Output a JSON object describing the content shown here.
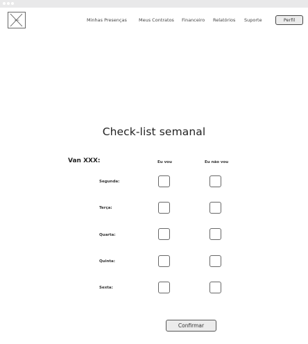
{
  "logo": {
    "text": "logo"
  },
  "nav": {
    "items": [
      {
        "label": "Minhas Presenças"
      },
      {
        "label": "Meus Contratos"
      },
      {
        "label": "Financeiro"
      },
      {
        "label": "Relatórios"
      },
      {
        "label": "Suporte"
      }
    ],
    "profile_label": "Perfil"
  },
  "main": {
    "title": "Check-list semanal",
    "van_label": "Van XXX:",
    "columns": [
      "Eu vou",
      "Eu não vou"
    ],
    "days": [
      {
        "label": "Segunda:",
        "eu_vou": false,
        "eu_nao_vou": false
      },
      {
        "label": "Terça:",
        "eu_vou": false,
        "eu_nao_vou": false
      },
      {
        "label": "Quarta:",
        "eu_vou": false,
        "eu_nao_vou": false
      },
      {
        "label": "Quinta:",
        "eu_vou": false,
        "eu_nao_vou": false
      },
      {
        "label": "Sexta:",
        "eu_vou": false,
        "eu_nao_vou": false
      }
    ],
    "confirm_label": "Confirmar"
  }
}
